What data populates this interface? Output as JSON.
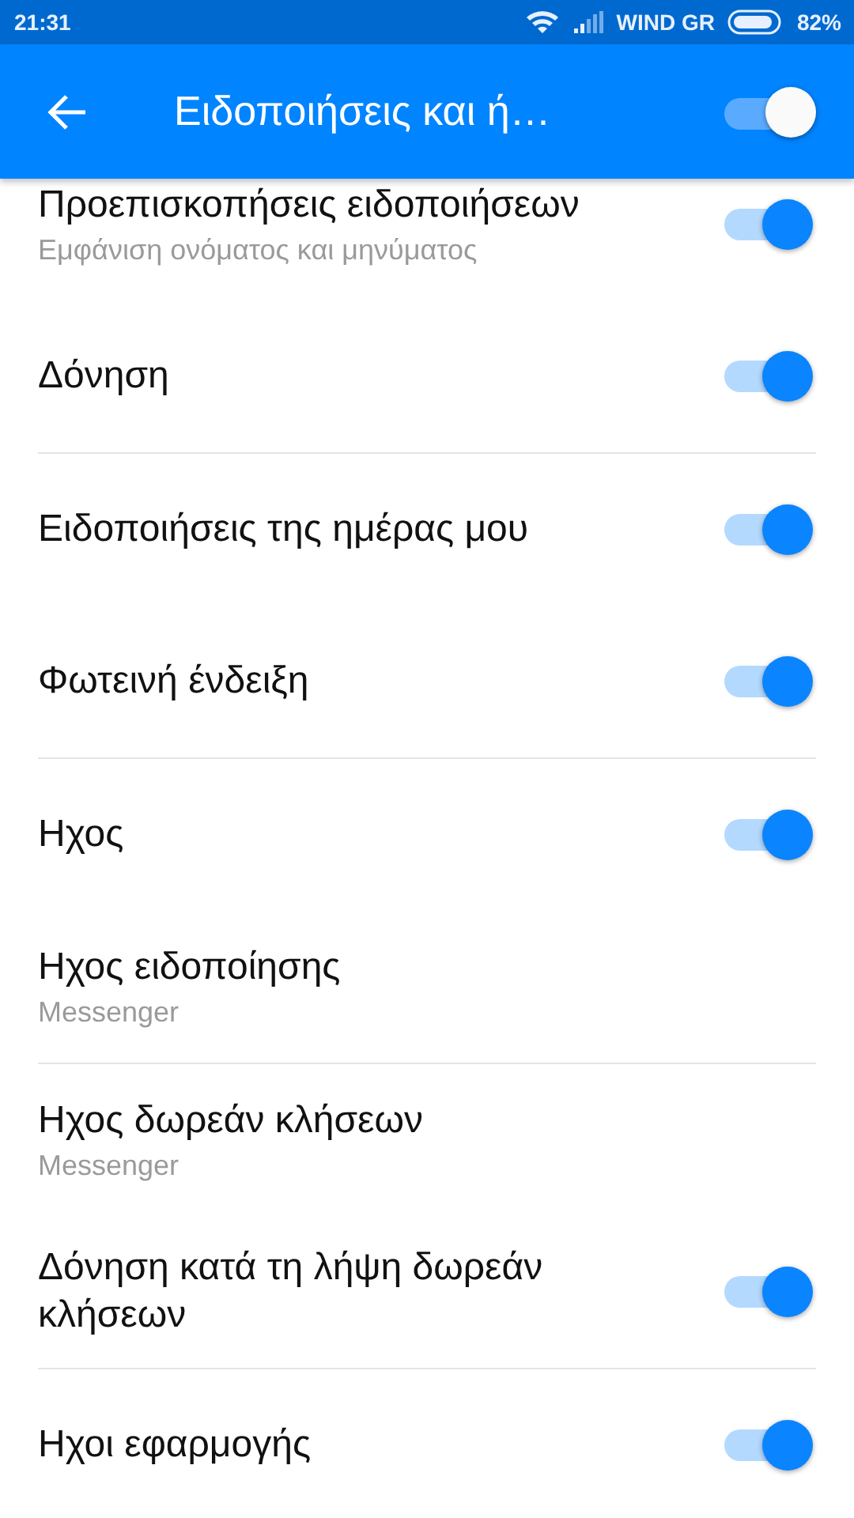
{
  "status_bar": {
    "time": "21:31",
    "carrier": "WIND GR",
    "battery": "82%"
  },
  "app_bar": {
    "title": "Ειδοποιήσεις και ή…",
    "on": true
  },
  "sections": [
    {
      "items": [
        {
          "kind": "toggle",
          "title": "Προεπισκοπήσεις ειδοποιήσεων",
          "subtitle": "Εμφάνιση ονόματος και μηνύματος",
          "on": true
        },
        {
          "kind": "toggle",
          "title": "Δόνηση",
          "on": true
        }
      ]
    },
    {
      "items": [
        {
          "kind": "toggle",
          "title": "Ειδοποιήσεις της ημέρας μου",
          "on": true
        },
        {
          "kind": "toggle",
          "title": "Φωτεινή ένδειξη",
          "on": true
        }
      ]
    },
    {
      "items": [
        {
          "kind": "toggle",
          "title": "Ηχος",
          "on": true
        },
        {
          "kind": "link",
          "title": "Ηχος ειδοποίησης",
          "subtitle": "Messenger"
        }
      ]
    },
    {
      "items": [
        {
          "kind": "link",
          "title": "Ηχος δωρεάν κλήσεων",
          "subtitle": "Messenger"
        },
        {
          "kind": "toggle",
          "title": "Δόνηση κατά τη λήψη δωρεάν κλήσεων",
          "on": true
        }
      ]
    },
    {
      "items": [
        {
          "kind": "toggle",
          "title": "Ηχοι εφαρμογής",
          "on": true
        }
      ]
    }
  ]
}
